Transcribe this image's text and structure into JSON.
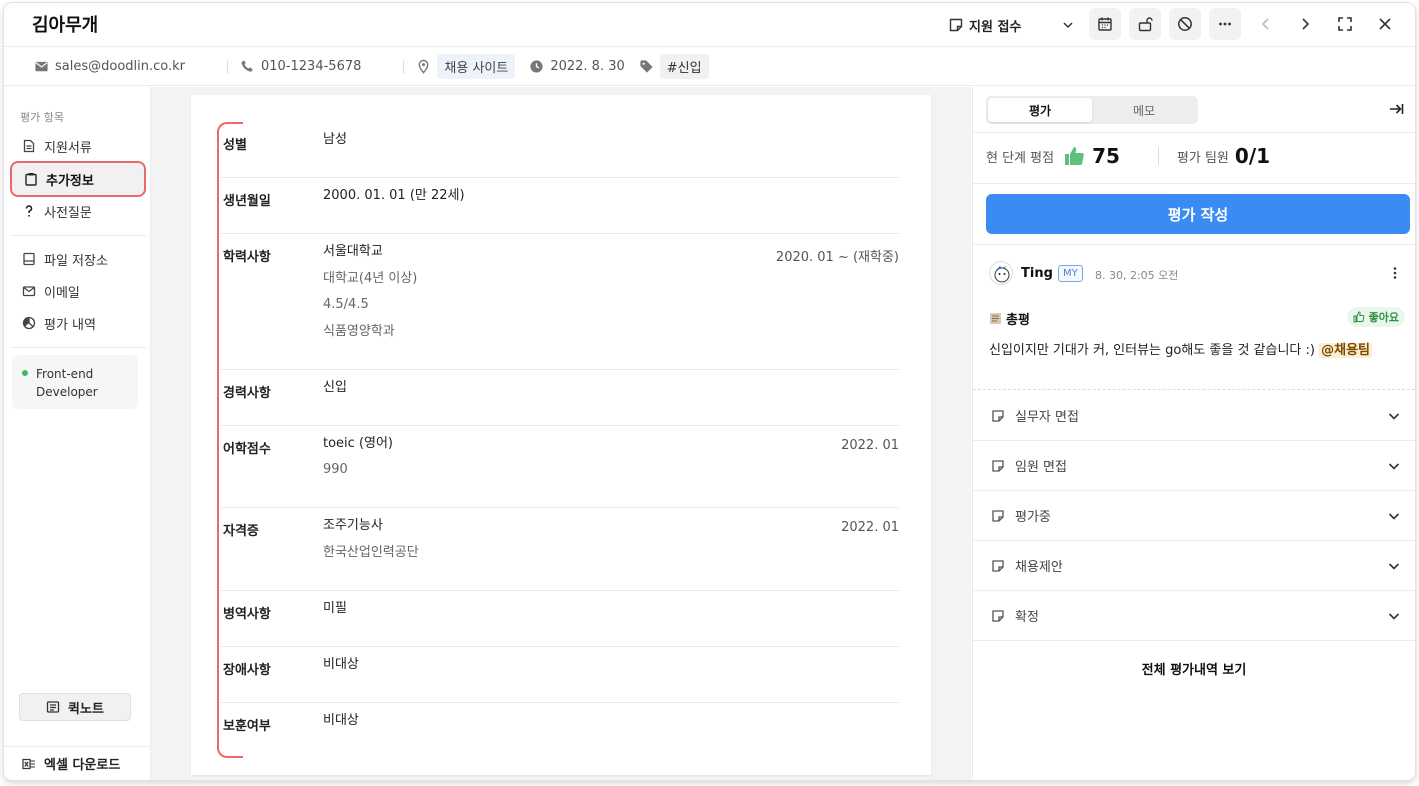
{
  "header": {
    "candidate_name": "김아무개",
    "stage_label": "지원 접수"
  },
  "contact": {
    "email": "sales@doodlin.co.kr",
    "phone": "010-1234-5678",
    "source": "채용 사이트",
    "date": "2022. 8. 30",
    "tag": "#신입"
  },
  "sidebar": {
    "section_title": "평가 항목",
    "items": [
      {
        "label": "지원서류"
      },
      {
        "label": "추가정보"
      },
      {
        "label": "사전질문"
      },
      {
        "label": "파일 저장소"
      },
      {
        "label": "이메일"
      },
      {
        "label": "평가 내역"
      }
    ],
    "job": {
      "line1": "Front-end",
      "line2": "Developer"
    },
    "quick_note": "퀵노트",
    "excel": "엑셀 다운로드"
  },
  "details": [
    {
      "label": "성별",
      "lines": [
        "남성"
      ],
      "date": ""
    },
    {
      "label": "생년월일",
      "lines": [
        "2000. 01. 01 (만 22세)"
      ],
      "date": ""
    },
    {
      "label": "학력사항",
      "lines": [
        "서울대학교",
        "대학교(4년 이상)",
        "4.5/4.5",
        "식품영양학과"
      ],
      "date": "2020. 01 ~ (재학중)"
    },
    {
      "label": "경력사항",
      "lines": [
        "신입"
      ],
      "date": ""
    },
    {
      "label": "어학점수",
      "lines": [
        "toeic (영어)",
        "990"
      ],
      "date": "2022. 01"
    },
    {
      "label": "자격증",
      "lines": [
        "조주기능사",
        "한국산업인력공단"
      ],
      "date": "2022. 01"
    },
    {
      "label": "병역사항",
      "lines": [
        "미필"
      ],
      "date": ""
    },
    {
      "label": "장애사항",
      "lines": [
        "비대상"
      ],
      "date": ""
    },
    {
      "label": "보훈여부",
      "lines": [
        "비대상"
      ],
      "date": ""
    }
  ],
  "right": {
    "tabs": [
      "평가",
      "메모"
    ],
    "score_label": "현 단계 평점",
    "score_value": "75",
    "team_label": "평가 팀원",
    "team_value": "0/1",
    "write_button": "평가 작성",
    "review": {
      "author": "Ting",
      "badge": "MY",
      "time": "8. 30, 2:05 오전",
      "title": "총평",
      "rating": "좋아요",
      "body": "신입이지만 기대가 커, 인터뷰는 go해도 좋을 것 같습니다 :)",
      "mention": "@채용팀"
    },
    "stages": [
      "실무자 면접",
      "임원 면접",
      "평가중",
      "채용제안",
      "확정"
    ],
    "view_all": "전체 평가내역 보기"
  },
  "colors": {
    "accent": "#3a8bf2",
    "highlight": "#e86a6a",
    "positive": "#3dbb5e"
  }
}
